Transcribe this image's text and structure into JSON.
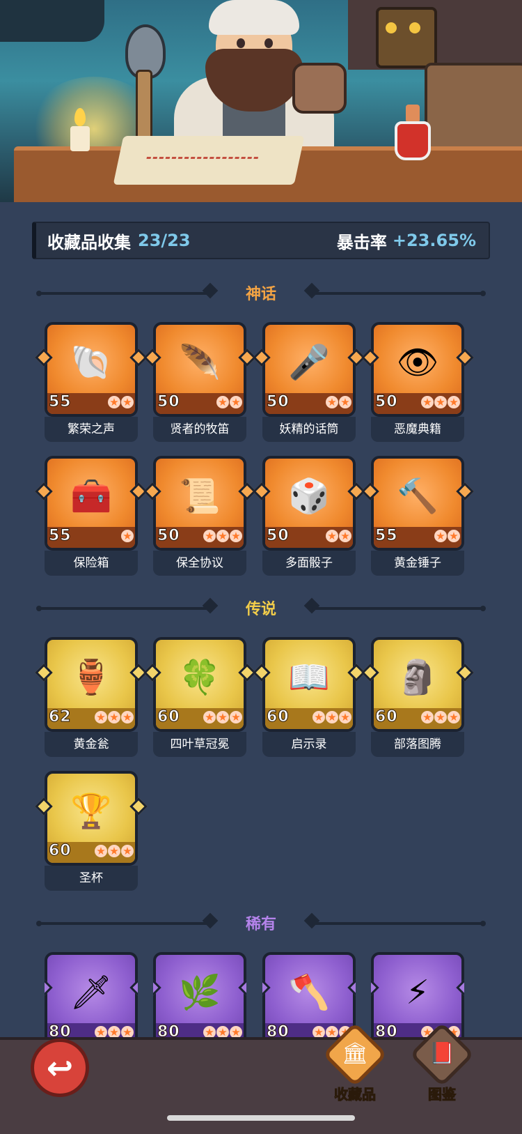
{
  "summary": {
    "collection_label": "收藏品收集",
    "collection_value": "23/23",
    "crit_label": "暴击率",
    "crit_value": "+23.65%"
  },
  "sections": {
    "mythic": {
      "title": "神话",
      "color": "#f4a444"
    },
    "legendary": {
      "title": "传说",
      "color": "#f2cd4a"
    },
    "rare": {
      "title": "稀有",
      "color": "#b483ea"
    }
  },
  "mythic_items": [
    {
      "name": "繁荣之声",
      "level": "55",
      "stars": 2,
      "icon": "conch-shell-icon",
      "glyph": "🐚"
    },
    {
      "name": "贤者的牧笛",
      "level": "50",
      "stars": 2,
      "icon": "flute-icon",
      "glyph": "🪶"
    },
    {
      "name": "妖精的话筒",
      "level": "50",
      "stars": 2,
      "icon": "microphone-icon",
      "glyph": "🎤"
    },
    {
      "name": "恶魔典籍",
      "level": "50",
      "stars": 3,
      "icon": "demon-book-icon",
      "glyph": "👁"
    },
    {
      "name": "保险箱",
      "level": "55",
      "stars": 1,
      "icon": "treasure-chest-icon",
      "glyph": "🧰"
    },
    {
      "name": "保全协议",
      "level": "50",
      "stars": 3,
      "icon": "contract-icon",
      "glyph": "📜"
    },
    {
      "name": "多面骰子",
      "level": "50",
      "stars": 2,
      "icon": "dice-icon",
      "glyph": "🎲"
    },
    {
      "name": "黄金锤子",
      "level": "55",
      "stars": 2,
      "icon": "hammer-icon",
      "glyph": "🔨"
    }
  ],
  "legendary_items": [
    {
      "name": "黄金瓮",
      "level": "62",
      "stars": 3,
      "icon": "urn-icon",
      "glyph": "🏺"
    },
    {
      "name": "四叶草冠冕",
      "level": "60",
      "stars": 3,
      "icon": "clover-crown-icon",
      "glyph": "🍀"
    },
    {
      "name": "启示录",
      "level": "60",
      "stars": 3,
      "icon": "open-book-icon",
      "glyph": "📖"
    },
    {
      "name": "部落图腾",
      "level": "60",
      "stars": 3,
      "icon": "totem-icon",
      "glyph": "🗿"
    },
    {
      "name": "圣杯",
      "level": "60",
      "stars": 3,
      "icon": "chalice-icon",
      "glyph": "🏆"
    }
  ],
  "rare_items": [
    {
      "name": "",
      "level": "80",
      "stars": 3,
      "icon": "ice-dagger-icon",
      "glyph": "🗡"
    },
    {
      "name": "",
      "level": "80",
      "stars": 3,
      "icon": "thorn-vine-icon",
      "glyph": "🌿"
    },
    {
      "name": "",
      "level": "80",
      "stars": 3,
      "icon": "axe-icon",
      "glyph": "🪓"
    },
    {
      "name": "",
      "level": "80",
      "stars": 3,
      "icon": "lightning-card-icon",
      "glyph": "⚡"
    }
  ],
  "nav": {
    "back_glyph": "↩",
    "collectibles_label": "收藏品",
    "collectibles_glyph": "🏛",
    "codex_label": "图鉴",
    "codex_glyph": "📕"
  }
}
